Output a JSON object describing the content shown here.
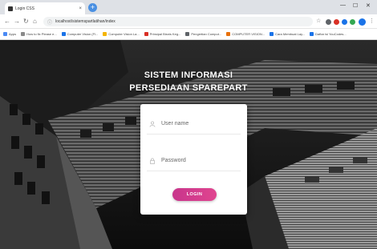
{
  "browser": {
    "tab_title": "Login CSS",
    "tab_close": "×",
    "new_tab": "+",
    "url": "localhost/sistemspartlatihan/index",
    "window_min": "—",
    "window_max": "☐",
    "window_close": "✕",
    "bookmarks": [
      {
        "label": "Apps",
        "color": "#4a8af4"
      },
      {
        "label": "How to fix Please e...",
        "color": "#8a8a8a"
      },
      {
        "label": "Computer Vision (Fl...",
        "color": "#1a73e8"
      },
      {
        "label": "Computer Vision La...",
        "color": "#f4b400"
      },
      {
        "label": "Prinsipal Bisnis Keg...",
        "color": "#d93025"
      },
      {
        "label": "Pengertian Comput...",
        "color": "#5f6368"
      },
      {
        "label": "COMPUTER VISION...",
        "color": "#e8710a"
      },
      {
        "label": "Cara Membuat Lay...",
        "color": "#1a73e8"
      },
      {
        "label": "Daftar isi YouCodes...",
        "color": "#1a73e8"
      }
    ]
  },
  "page": {
    "title_line1": "SISTEM INFORMASI",
    "title_line2": "PERSEDIAAN SPAREPART",
    "username_placeholder": "User name",
    "password_placeholder": "Password",
    "login_label": "LOGIN"
  },
  "colors": {
    "accent_start": "#c8358c",
    "accent_end": "#e0458f"
  }
}
